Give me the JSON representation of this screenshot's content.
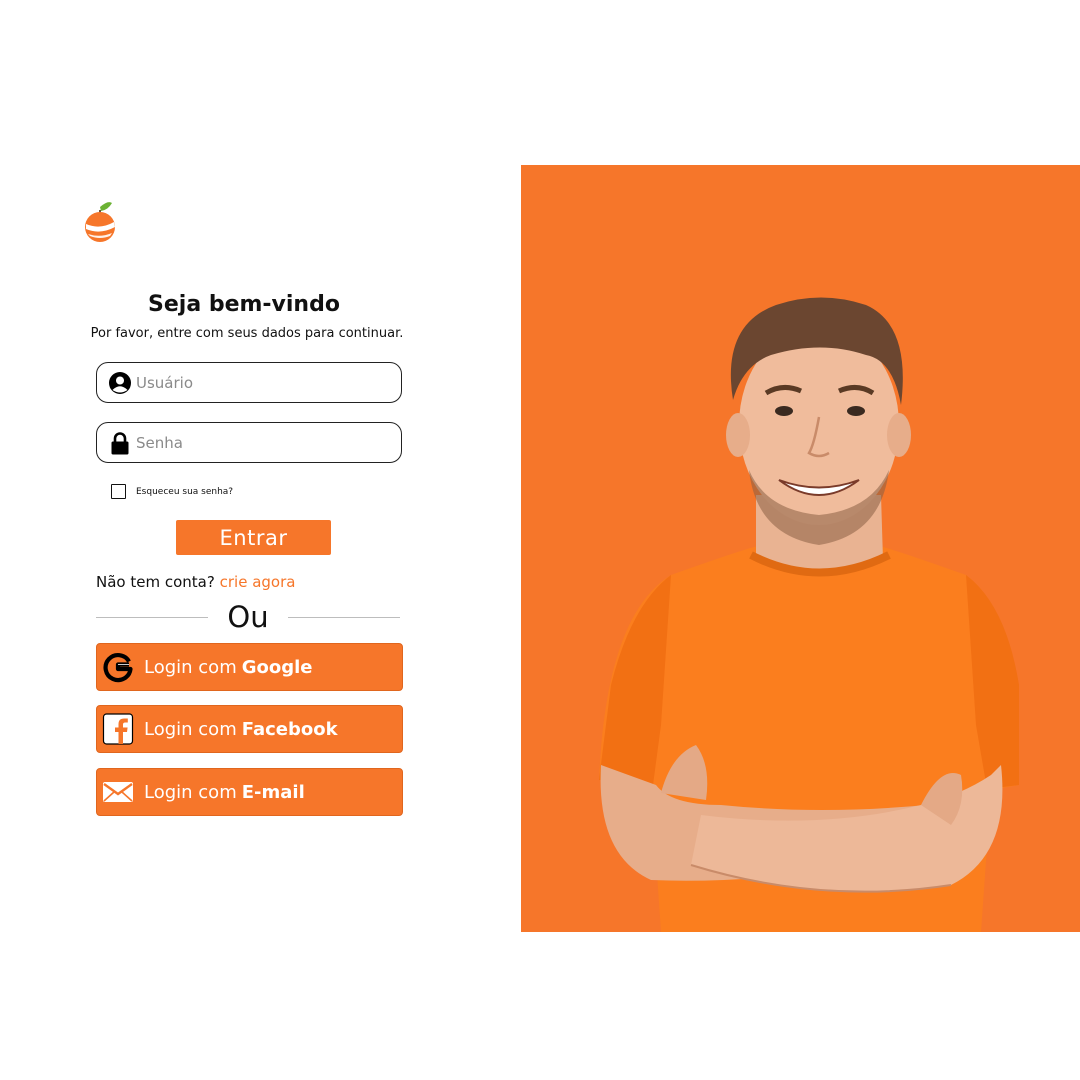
{
  "brand": {
    "accent_color": "#F6762A",
    "logo_icon": "orange-fruit-logo"
  },
  "login": {
    "title": "Seja bem-vindo",
    "subtitle": "Por favor, entre com seus dados para continuar.",
    "username": {
      "placeholder": "Usuário",
      "icon": "user-icon"
    },
    "password": {
      "placeholder": "Senha",
      "icon": "lock-icon"
    },
    "forgot_label": "Esqueceu sua senha?",
    "submit_label": "Entrar",
    "signup_prompt": "Não tem conta?",
    "signup_link": "crie agora",
    "divider_label": "Ou"
  },
  "social": [
    {
      "prefix": "Login com",
      "provider": "Google",
      "icon": "google-icon"
    },
    {
      "prefix": "Login com",
      "provider": "Facebook",
      "icon": "facebook-icon"
    },
    {
      "prefix": "Login com",
      "provider": "E-mail",
      "icon": "email-icon"
    }
  ],
  "hero": {
    "background_color": "#F6762A",
    "image": "smiling-man-orange-tshirt"
  }
}
